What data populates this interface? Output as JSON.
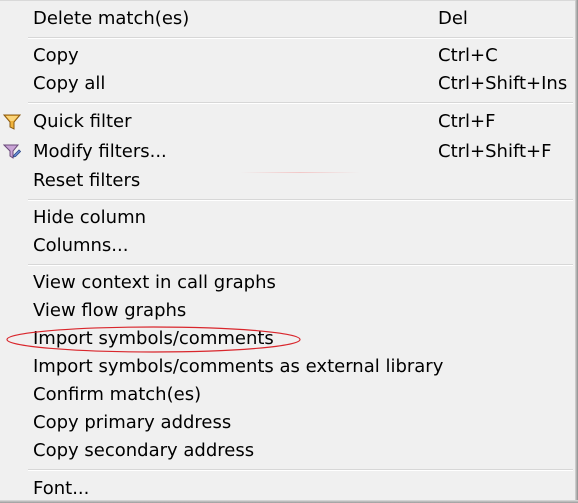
{
  "menu": {
    "items": [
      {
        "label": "Delete match(es)",
        "shortcut": "Del"
      },
      {
        "label": "Copy",
        "shortcut": "Ctrl+C"
      },
      {
        "label": "Copy all",
        "shortcut": "Ctrl+Shift+Ins"
      },
      {
        "label": "Quick filter",
        "shortcut": "Ctrl+F",
        "icon": "funnel-icon"
      },
      {
        "label": "Modify filters...",
        "shortcut": "Ctrl+Shift+F",
        "icon": "funnel-edit-icon"
      },
      {
        "label": "Reset filters",
        "shortcut": ""
      },
      {
        "label": "Hide column",
        "shortcut": ""
      },
      {
        "label": "Columns...",
        "shortcut": ""
      },
      {
        "label": "View context in call graphs",
        "shortcut": ""
      },
      {
        "label": "View flow graphs",
        "shortcut": ""
      },
      {
        "label": "Import symbols/comments",
        "shortcut": "",
        "highlighted_by_annotation": true
      },
      {
        "label": "Import symbols/comments as external library",
        "shortcut": ""
      },
      {
        "label": "Confirm match(es)",
        "shortcut": ""
      },
      {
        "label": "Copy primary address",
        "shortcut": ""
      },
      {
        "label": "Copy secondary address",
        "shortcut": ""
      },
      {
        "label": "Font...",
        "shortcut": ""
      }
    ]
  },
  "colors": {
    "menu_background": "#f0f0f0",
    "separator": "#d7d7d7",
    "annotation_ellipse": "#d9262c",
    "funnel_icon": "#e8a530"
  }
}
